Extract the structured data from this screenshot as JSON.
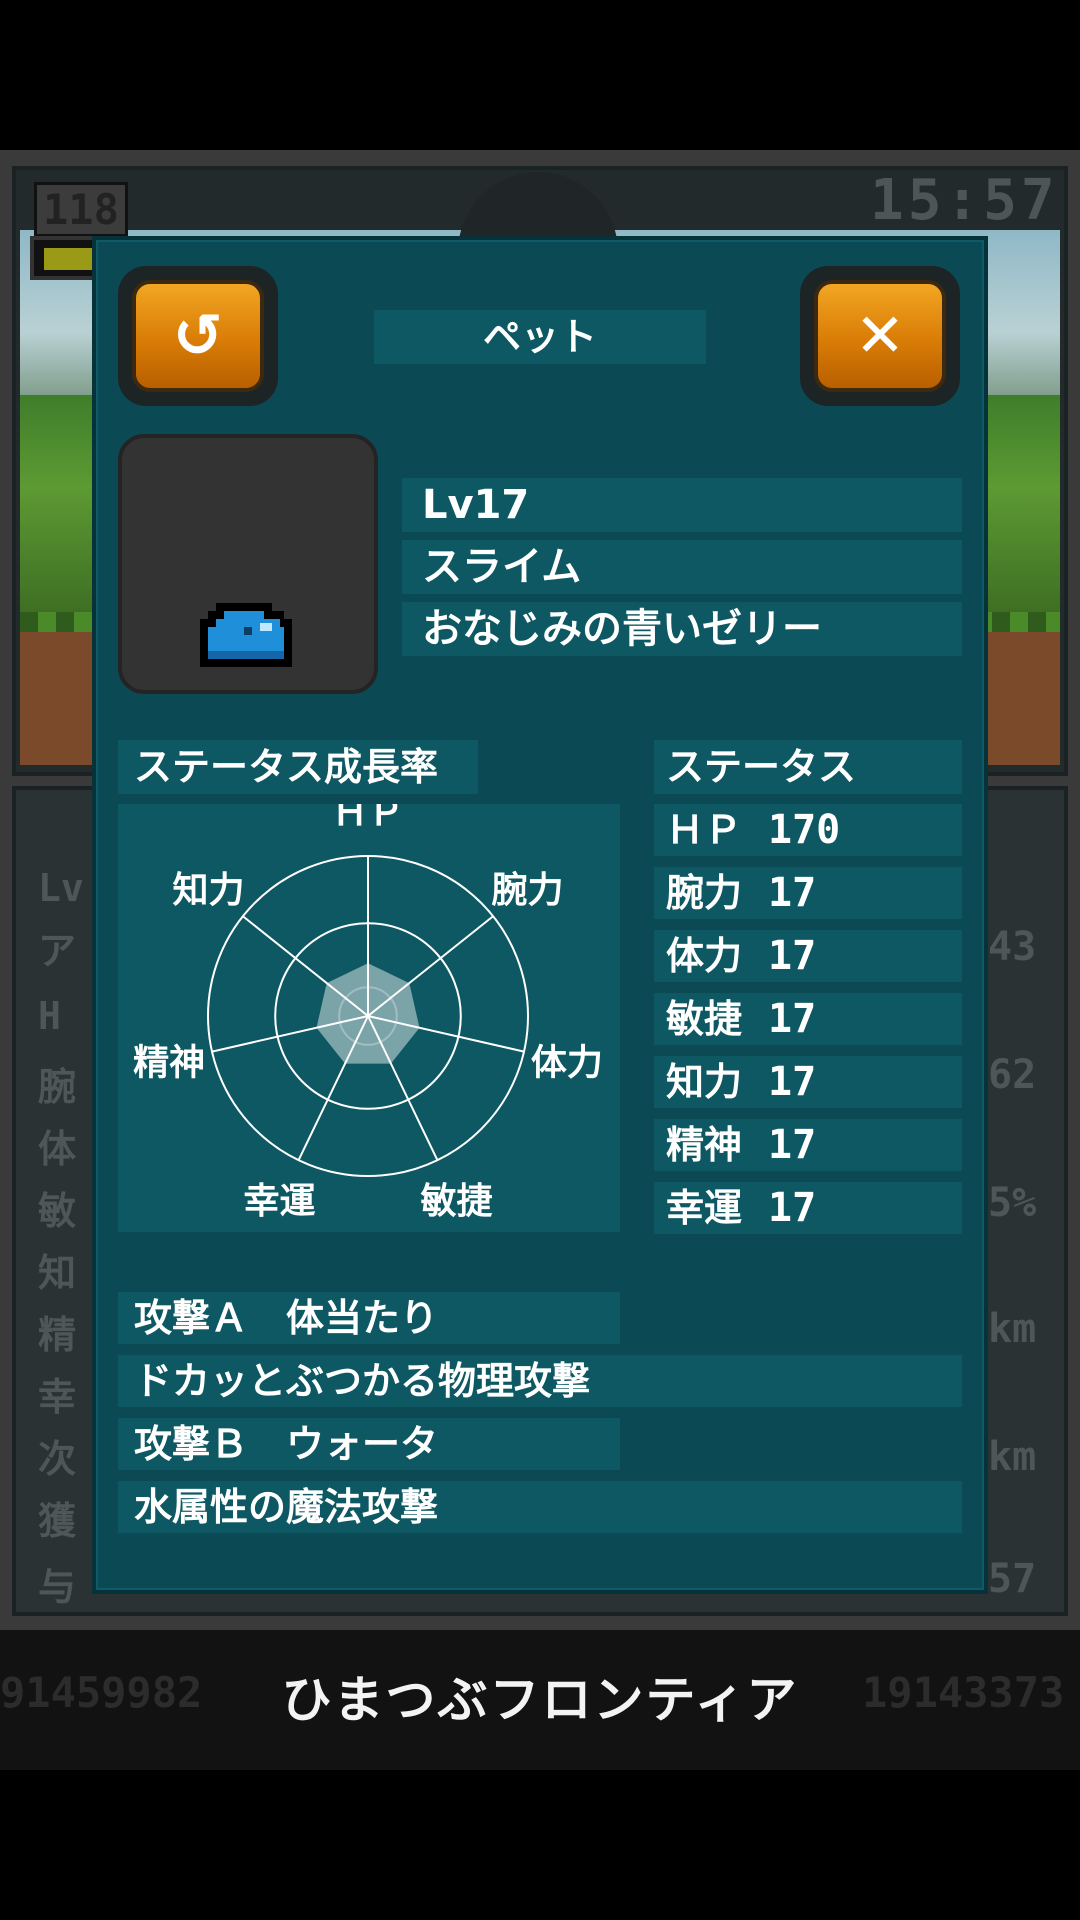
{
  "background": {
    "level": "118",
    "clock": "15:57",
    "left_labels": [
      "Lv",
      "ア",
      "H",
      "腕",
      "体",
      "敏",
      "知",
      "精",
      "幸",
      "次",
      "獲",
      "与"
    ],
    "right_values": [
      "43",
      "62",
      "5%",
      "km",
      "km",
      "57"
    ],
    "score_left": "91459982",
    "score_right": "19143373",
    "footer_title": "ひまつぶフロンティア"
  },
  "panel": {
    "title": "ペット",
    "back_icon": "↺",
    "close_icon": "✕"
  },
  "pet": {
    "level": "Lv17",
    "name": "スライム",
    "description": "おなじみの青いゼリー",
    "sprite_color": "#1e8fd8"
  },
  "growth": {
    "title": "ステータス成長率",
    "axes": [
      "ＨＰ",
      "腕力",
      "体力",
      "敏捷",
      "幸運",
      "精神",
      "知力"
    ],
    "values": [
      0.33,
      0.33,
      0.33,
      0.33,
      0.33,
      0.33,
      0.33
    ]
  },
  "status": {
    "title": "ステータス",
    "rows": [
      {
        "name": "ＨＰ",
        "value": "170"
      },
      {
        "name": "腕力",
        "value": "17"
      },
      {
        "name": "体力",
        "value": "17"
      },
      {
        "name": "敏捷",
        "value": "17"
      },
      {
        "name": "知力",
        "value": "17"
      },
      {
        "name": "精神",
        "value": "17"
      },
      {
        "name": "幸運",
        "value": "17"
      }
    ]
  },
  "skills": {
    "attack_a": "攻撃Ａ　体当たり",
    "attack_a_desc": "ドカッとぶつかる物理攻撃",
    "attack_b": "攻撃Ｂ　ウォータ",
    "attack_b_desc": "水属性の魔法攻撃"
  }
}
